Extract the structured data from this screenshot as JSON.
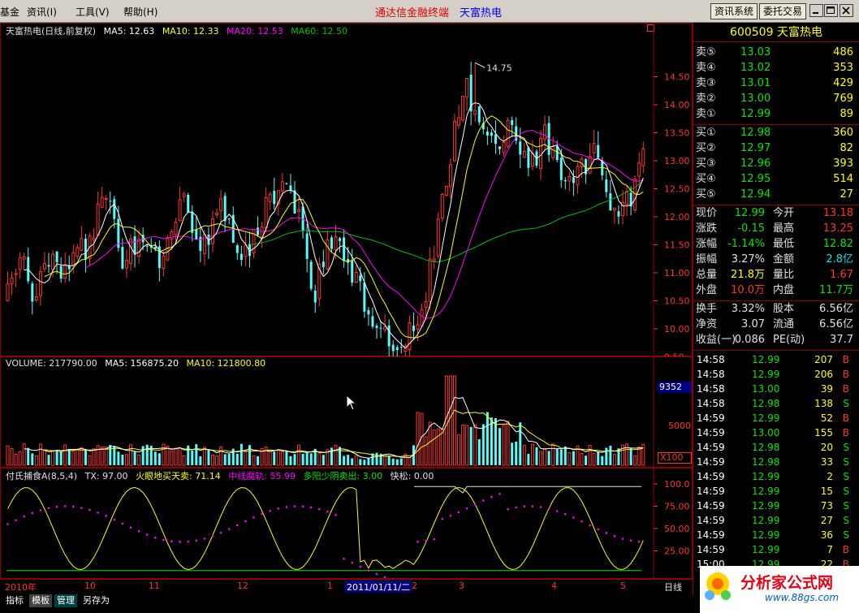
{
  "menubar": {
    "left_cut": "基金",
    "items": [
      "资讯(I)",
      "工具(V)",
      "帮助(H)"
    ],
    "brand_main": "通达信金融终端",
    "brand_stock": "天富热电",
    "btn_info": "资讯系统",
    "btn_trade": "委托交易"
  },
  "price_panel": {
    "legend": {
      "name": "天富热电(日线,前复权)",
      "ma5": "MA5: 12.63",
      "ma10": "MA10: 12.33",
      "ma20": "MA20: 12.53",
      "ma60": "MA60: 12.50"
    },
    "high_mark": "14.75",
    "low_mark": "9.35",
    "y_ticks": [
      "14.50",
      "14.00",
      "13.50",
      "13.00",
      "12.50",
      "12.00",
      "11.50",
      "11.00",
      "10.50",
      "10.00",
      "9.50"
    ]
  },
  "volume_panel": {
    "legend": {
      "name": "VOLUME: 217790.00",
      "ma5": "MA5: 156875.20",
      "ma10": "MA10: 121800.80"
    },
    "current": "9352",
    "tick": "5000",
    "unit": "X100"
  },
  "indicator_panel": {
    "legend": {
      "name": "付氏捕食A(8,5,4)",
      "tx": "TX: 97.00",
      "l1": "火眼地买天卖: 71.14",
      "l2": "中线魔轨: 55.99",
      "l3": "多阳少阴卖出: 3.00",
      "l4": "快松: 0.00"
    },
    "y_ticks": [
      "100.0",
      "75.00",
      "50.00",
      "25.00"
    ]
  },
  "date_axis": {
    "labels": [
      "2010年",
      "10",
      "11",
      "12",
      "1",
      "2011/01/11/二",
      "2",
      "3",
      "4",
      "5"
    ],
    "period": "日线"
  },
  "tabs": [
    "指标",
    "模板",
    "管理",
    "另存为"
  ],
  "quote": {
    "code": "600509",
    "name": "天富热电",
    "asks": [
      {
        "label": "卖⑤",
        "price": "13.03",
        "vol": "486"
      },
      {
        "label": "卖④",
        "price": "13.02",
        "vol": "353"
      },
      {
        "label": "卖③",
        "price": "13.01",
        "vol": "429"
      },
      {
        "label": "卖②",
        "price": "13.00",
        "vol": "769"
      },
      {
        "label": "卖①",
        "price": "12.99",
        "vol": "89"
      }
    ],
    "bids": [
      {
        "label": "买①",
        "price": "12.98",
        "vol": "360"
      },
      {
        "label": "买②",
        "price": "12.97",
        "vol": "82"
      },
      {
        "label": "买③",
        "price": "12.96",
        "vol": "393"
      },
      {
        "label": "买④",
        "price": "12.95",
        "vol": "514"
      },
      {
        "label": "买⑤",
        "price": "12.94",
        "vol": "27"
      }
    ],
    "stats": [
      {
        "l1": "现价",
        "v1": "12.99",
        "l2": "今开",
        "v2": "13.18"
      },
      {
        "l1": "涨跌",
        "v1": "-0.15",
        "l2": "最高",
        "v2": "13.25"
      },
      {
        "l1": "涨幅",
        "v1": "-1.14%",
        "l2": "最低",
        "v2": "12.82"
      },
      {
        "l1": "振幅",
        "v1": "3.27%",
        "l2": "金额",
        "v2": "2.8亿"
      },
      {
        "l1": "总量",
        "v1": "21.8万",
        "l2": "量比",
        "v2": "1.67"
      },
      {
        "l1": "外盘",
        "v1": "10.0万",
        "l2": "内盘",
        "v2": "11.7万"
      }
    ],
    "fin": [
      {
        "l1": "换手",
        "v1": "3.32%",
        "l2": "股本",
        "v2": "6.56亿"
      },
      {
        "l1": "净资",
        "v1": "3.07",
        "l2": "流通",
        "v2": "6.56亿"
      },
      {
        "l1": "收益(一)",
        "v1": "0.086",
        "l2": "PE(动)",
        "v2": "37.7"
      }
    ],
    "ticks": [
      {
        "t": "14:58",
        "p": "12.99",
        "v": "207",
        "bs": "B"
      },
      {
        "t": "14:58",
        "p": "12.99",
        "v": "206",
        "bs": "B"
      },
      {
        "t": "14:58",
        "p": "13.00",
        "v": "39",
        "bs": "B"
      },
      {
        "t": "14:58",
        "p": "12.98",
        "v": "138",
        "bs": "S"
      },
      {
        "t": "14:59",
        "p": "12.99",
        "v": "52",
        "bs": "B"
      },
      {
        "t": "14:59",
        "p": "13.00",
        "v": "155",
        "bs": "B"
      },
      {
        "t": "14:59",
        "p": "12.98",
        "v": "20",
        "bs": "S"
      },
      {
        "t": "14:59",
        "p": "12.98",
        "v": "33",
        "bs": "S"
      },
      {
        "t": "14:59",
        "p": "12.99",
        "v": "2",
        "bs": "S"
      },
      {
        "t": "14:59",
        "p": "12.99",
        "v": "15",
        "bs": "S"
      },
      {
        "t": "14:59",
        "p": "12.99",
        "v": "73",
        "bs": "S"
      },
      {
        "t": "14:59",
        "p": "12.99",
        "v": "27",
        "bs": "S"
      },
      {
        "t": "14:59",
        "p": "12.99",
        "v": "36",
        "bs": "S"
      },
      {
        "t": "14:59",
        "p": "12.99",
        "v": "7",
        "bs": "B"
      },
      {
        "t": "15:00",
        "p": "12.99",
        "v": "22",
        "bs": "B"
      }
    ]
  },
  "logo": {
    "text": "分析家公式网",
    "url": "www.88gs.com"
  },
  "colors": {
    "up": "#ff3232",
    "down": "#54fcfc",
    "ma5": "#ffffff",
    "ma10": "#ffff00",
    "ma20": "#ff00ff",
    "ma60": "#00c000",
    "grid": "#8b0000"
  }
}
